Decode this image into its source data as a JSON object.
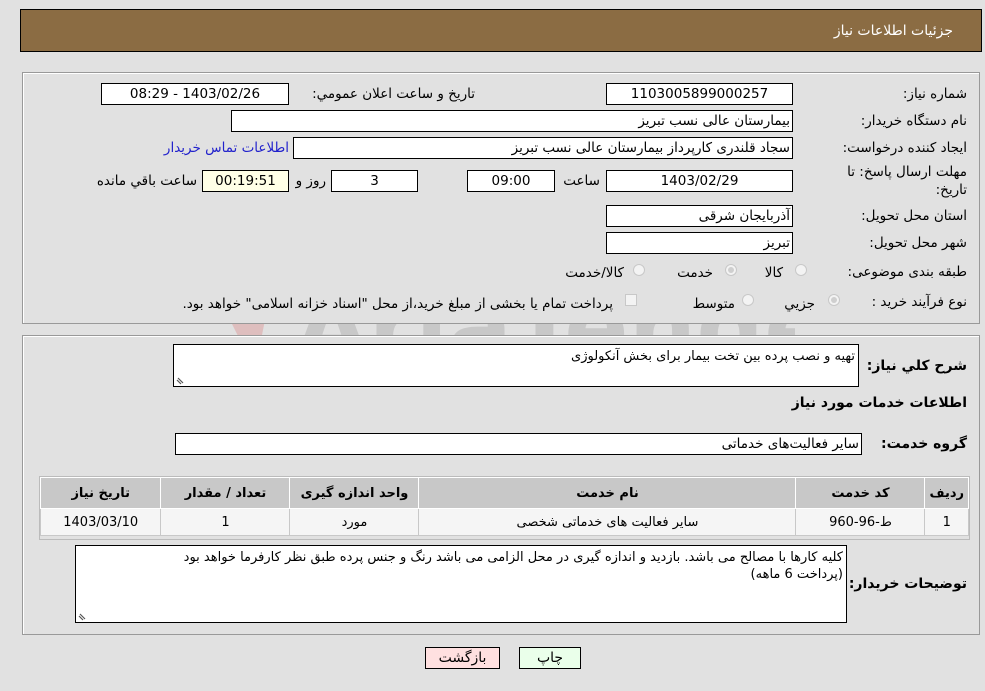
{
  "header": {
    "title": "جزئیات اطلاعات نیاز"
  },
  "form": {
    "need_number": {
      "label": "شماره نیاز:",
      "value": "1103005899000257"
    },
    "announce_datetime": {
      "label": "تاریخ و ساعت اعلان عمومي:",
      "value": "1403/02/26 - 08:29"
    },
    "buyer_org": {
      "label": "نام دستگاه خریدار:",
      "value": "بیمارستان عالی نسب تبریز"
    },
    "requester": {
      "label": "ایجاد کننده درخواست:",
      "value": "سجاد قلندری کارپرداز بیمارستان عالی نسب تبریز"
    },
    "contact_link": "اطلاعات تماس خریدار",
    "deadline": {
      "label_line1": "مهلت ارسال پاسخ: تا",
      "label_line2": "تاریخ:",
      "date": "1403/02/29",
      "time_label": "ساعت",
      "time": "09:00",
      "days": "3",
      "days_label": "روز و",
      "remaining": "00:19:51",
      "remaining_label": "ساعت باقي مانده"
    },
    "province": {
      "label": "استان محل تحویل:",
      "value": "آذربایجان شرقی"
    },
    "city": {
      "label": "شهر محل تحویل:",
      "value": "تبریز"
    },
    "category": {
      "label": "طبقه بندی موضوعی:",
      "options": [
        "کالا",
        "خدمت",
        "کالا/خدمت"
      ],
      "selected": "خدمت"
    },
    "process": {
      "label": "نوع فرآیند خرید :",
      "options": [
        "جزيي",
        "متوسط"
      ],
      "selected": "جزيي",
      "treasury_note": "پرداخت تمام یا بخشی از مبلغ خرید،از محل \"اسناد خزانه اسلامی\" خواهد بود."
    }
  },
  "details": {
    "summary_label": "شرح کلي نیاز:",
    "summary": "تهیه و نصب پرده بین تخت بیمار برای بخش آنکولوژی",
    "services_heading": "اطلاعات خدمات مورد نیاز",
    "service_group_label": "گروه خدمت:",
    "service_group": "سایر فعالیت‌های خدماتی",
    "table": {
      "headers": [
        "ردیف",
        "کد خدمت",
        "نام خدمت",
        "واحد اندازه گیری",
        "تعداد / مقدار",
        "تاریخ نیاز"
      ],
      "rows": [
        [
          "1",
          "ط-96-960",
          "سایر فعالیت های خدماتی شخصی",
          "مورد",
          "1",
          "1403/03/10"
        ]
      ]
    },
    "buyer_notes_label": "توضیحات خریدار:",
    "buyer_notes_line1": "کلیه کارها با مصالح می باشد. بازدید و اندازه گیری در محل الزامی می باشد رنگ و جنس پرده طبق نظر کارفرما خواهد بود",
    "buyer_notes_line2": "(پرداخت 6 ماهه)"
  },
  "buttons": {
    "print": "چاپ",
    "back": "بازگشت"
  },
  "watermark": "AriaTender.neT",
  "colors": {
    "header_bg": "#8b6c43",
    "print_bg": "#eaffea",
    "back_bg": "#ffe0e0",
    "link": "#2222cc"
  }
}
